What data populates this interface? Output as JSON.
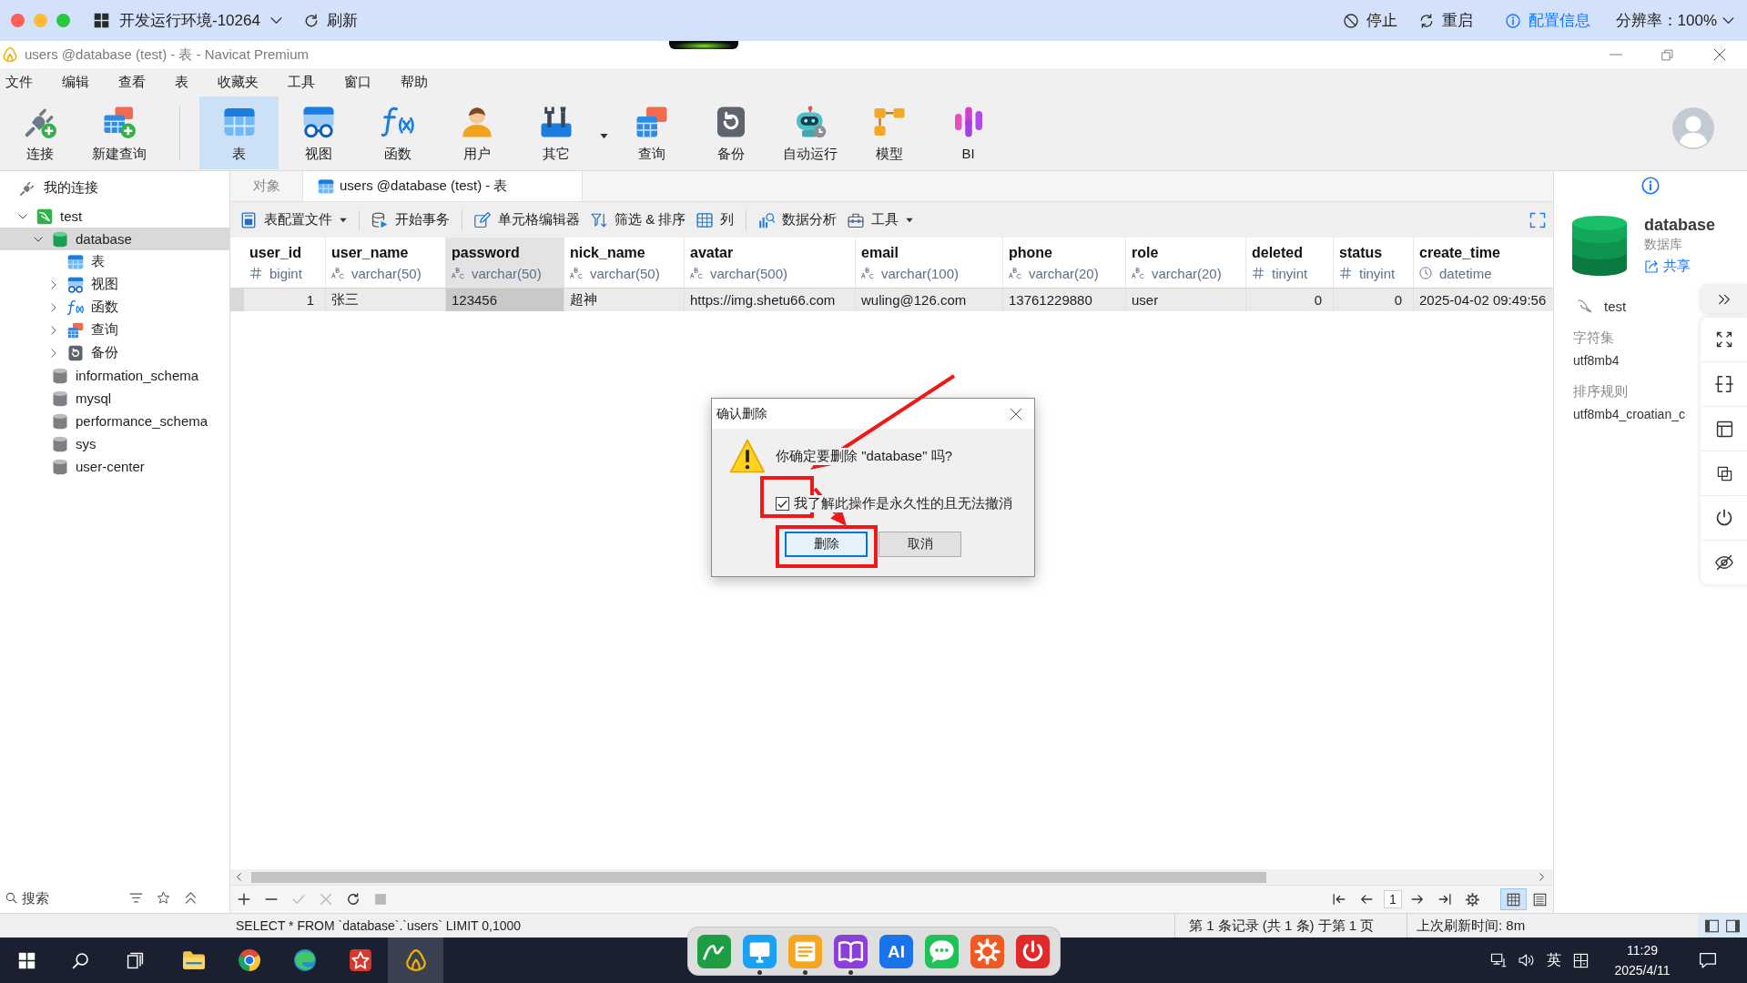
{
  "topbar": {
    "environment": "开发运行环境-10264",
    "refresh": "刷新",
    "actions": [
      {
        "kind": "stop",
        "label": "停止"
      },
      {
        "kind": "restart",
        "label": "重启"
      },
      {
        "kind": "info",
        "label": "配置信息"
      }
    ],
    "resolution": "分辨率：100%"
  },
  "window": {
    "title": "users @database (test) - 表 - Navicat Premium"
  },
  "menu": [
    "文件",
    "编辑",
    "查看",
    "表",
    "收藏夹",
    "工具",
    "窗口",
    "帮助"
  ],
  "toolbar": {
    "groups": [
      {
        "items": [
          {
            "kind": "connect",
            "label": "连接",
            "selected": false
          },
          {
            "kind": "new_query",
            "label": "新建查询",
            "selected": false
          }
        ]
      },
      {
        "items": [
          {
            "kind": "table",
            "label": "表",
            "selected": true
          },
          {
            "kind": "view",
            "label": "视图",
            "selected": false
          },
          {
            "kind": "function",
            "label": "函数",
            "selected": false
          },
          {
            "kind": "user",
            "label": "用户",
            "selected": false
          },
          {
            "kind": "other",
            "label": "其它",
            "selected": false,
            "dropdown": true
          },
          {
            "kind": "query",
            "label": "查询",
            "selected": false
          },
          {
            "kind": "backup",
            "label": "备份",
            "selected": false
          },
          {
            "kind": "automation",
            "label": "自动运行",
            "selected": false
          },
          {
            "kind": "model",
            "label": "模型",
            "selected": false
          },
          {
            "kind": "bi",
            "label": "BI",
            "selected": false
          }
        ]
      }
    ]
  },
  "sidebar": {
    "header": "我的连接",
    "tree": [
      {
        "label": "test",
        "kind": "connection",
        "expanded": true,
        "selected": false,
        "children": [
          {
            "label": "database",
            "kind": "database_open",
            "expanded": true,
            "selected": true,
            "children": [
              {
                "label": "表",
                "kind": "tables",
                "selected": false
              },
              {
                "label": "视图",
                "kind": "views",
                "expanded": false,
                "selected": false
              },
              {
                "label": "函数",
                "kind": "functions",
                "expanded": false,
                "selected": false
              },
              {
                "label": "查询",
                "kind": "queries",
                "expanded": false,
                "selected": false
              },
              {
                "label": "备份",
                "kind": "backups",
                "expanded": false,
                "selected": false
              }
            ]
          },
          {
            "label": "information_schema",
            "kind": "database",
            "selected": false
          },
          {
            "label": "mysql",
            "kind": "database",
            "selected": false
          },
          {
            "label": "performance_schema",
            "kind": "database",
            "selected": false
          },
          {
            "label": "sys",
            "kind": "database",
            "selected": false
          },
          {
            "label": "user-center",
            "kind": "database",
            "selected": false
          }
        ]
      }
    ],
    "search": {
      "placeholder": "搜索"
    }
  },
  "tabs": [
    {
      "kind": "objects",
      "label": "对象",
      "selected": false
    },
    {
      "kind": "table",
      "label": "users @database (test) - 表",
      "selected": true
    }
  ],
  "table_toolbar": {
    "groups": [
      {
        "items": [
          {
            "kind": "profile",
            "label": "表配置文件",
            "dropdown": true
          }
        ]
      },
      {
        "items": [
          {
            "kind": "transaction",
            "label": "开始事务"
          }
        ]
      },
      {
        "items": [
          {
            "kind": "cell_editor",
            "label": "单元格编辑器"
          },
          {
            "kind": "filter",
            "label": "筛选 & 排序"
          },
          {
            "kind": "columns",
            "label": "列"
          }
        ]
      },
      {
        "items": [
          {
            "kind": "analysis",
            "label": "数据分析"
          },
          {
            "kind": "tools",
            "label": "工具",
            "dropdown": true
          }
        ]
      }
    ]
  },
  "table": {
    "columns": [
      {
        "name": "user_id",
        "type": "bigint",
        "kind": "number",
        "selected": false
      },
      {
        "name": "user_name",
        "type": "varchar(50)",
        "kind": "text",
        "selected": false
      },
      {
        "name": "password",
        "type": "varchar(50)",
        "kind": "text",
        "selected": true
      },
      {
        "name": "nick_name",
        "type": "varchar(50)",
        "kind": "text",
        "selected": false
      },
      {
        "name": "avatar",
        "type": "varchar(500)",
        "kind": "text",
        "selected": false
      },
      {
        "name": "email",
        "type": "varchar(100)",
        "kind": "text",
        "selected": false
      },
      {
        "name": "phone",
        "type": "varchar(20)",
        "kind": "text",
        "selected": false
      },
      {
        "name": "role",
        "type": "varchar(20)",
        "kind": "text",
        "selected": false
      },
      {
        "name": "deleted",
        "type": "tinyint",
        "kind": "number",
        "selected": false
      },
      {
        "name": "status",
        "type": "tinyint",
        "kind": "number",
        "selected": false
      },
      {
        "name": "create_time",
        "type": "datetime",
        "kind": "datetime",
        "selected": false
      }
    ],
    "rows": [
      {
        "selected": true,
        "cells": [
          "1",
          "张三",
          "123456",
          "超神",
          "https://img.shetu66.com",
          "wuling@126.com",
          "13761229880",
          "user",
          "0",
          "0",
          "2025-04-02 09:49:56"
        ]
      }
    ]
  },
  "record_actions": [
    {
      "kind": "add",
      "disabled": false
    },
    {
      "kind": "remove",
      "disabled": false
    },
    {
      "kind": "apply",
      "disabled": true
    },
    {
      "kind": "discard",
      "disabled": true
    },
    {
      "kind": "refresh",
      "disabled": false
    },
    {
      "kind": "stop",
      "disabled": true
    }
  ],
  "pager": {
    "page": "1",
    "view_modes": [
      {
        "kind": "grid",
        "selected": true
      },
      {
        "kind": "form",
        "selected": false
      }
    ]
  },
  "info_panel": {
    "name": "database",
    "type": "数据库",
    "share": "共享",
    "connection": "test",
    "properties": [
      {
        "label": "字符集",
        "value": "utf8mb4"
      },
      {
        "label": "排序规则",
        "value": "utf8mb4_croatian_c"
      }
    ]
  },
  "status_bar": {
    "sql": "SELECT * FROM `database`.`users` LIMIT 0,1000",
    "record": "第 1 条记录 (共 1 条) 于第 1 页",
    "refreshed": "上次刷新时间: 8m"
  },
  "dialog": {
    "title": "确认删除",
    "message": "你确定要删除 \"database\" 吗?",
    "acknowledge": {
      "label": "我了解此操作是永久性的且无法撤消",
      "checked": true
    },
    "buttons": [
      {
        "kind": "primary",
        "label": "删除"
      },
      {
        "kind": "secondary",
        "label": "取消"
      }
    ]
  },
  "taskbar": {
    "apps": [
      {
        "kind": "files",
        "selected": false
      },
      {
        "kind": "browser",
        "selected": false
      },
      {
        "kind": "browser_alt",
        "selected": false
      },
      {
        "kind": "tool",
        "selected": false
      },
      {
        "kind": "database_client",
        "selected": true
      }
    ],
    "dock": [
      {
        "kind": "pen",
        "running": false
      },
      {
        "kind": "monitor",
        "running": true
      },
      {
        "kind": "notes",
        "running": true
      },
      {
        "kind": "book",
        "running": true
      },
      {
        "kind": "ai",
        "label": "AI",
        "running": false
      },
      {
        "kind": "chat",
        "running": false
      },
      {
        "kind": "settings",
        "running": false
      },
      {
        "kind": "power",
        "running": false
      }
    ],
    "language": "英",
    "time": "11:29",
    "date": "2025/4/11"
  }
}
